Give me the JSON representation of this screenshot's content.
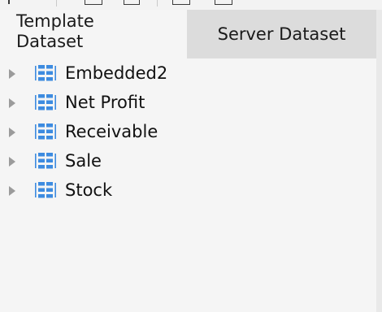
{
  "tabs": {
    "template_line1": "Template",
    "template_line2": "Dataset",
    "server": "Server Dataset"
  },
  "tree": {
    "items": [
      {
        "label": "Embedded2",
        "icon": "dataset-icon"
      },
      {
        "label": "Net Profit",
        "icon": "dataset-icon"
      },
      {
        "label": "Receivable",
        "icon": "dataset-icon"
      },
      {
        "label": "Sale",
        "icon": "dataset-icon"
      },
      {
        "label": "Stock",
        "icon": "dataset-icon"
      }
    ]
  },
  "colors": {
    "icon_blue": "#3d8be0",
    "active_tab_bg": "#f5f5f5",
    "inactive_tab_bg": "#dcdcdc"
  }
}
